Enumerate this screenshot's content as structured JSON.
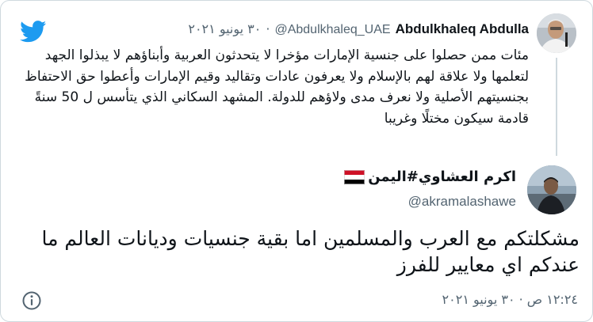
{
  "parent_tweet": {
    "author_name": "Abdulkhaleq Abdulla",
    "handle": "@Abdulkhaleq_UAE",
    "separator": "·",
    "date": "٣٠ يونيو ٢٠٢١",
    "text": "مئات ممن حصلوا على جنسية الإمارات مؤخرا لا يتحدثون العربية وأبناؤهم لا يبذلوا الجهد لتعلمها ولا علاقة لهم بالإسلام ولا يعرفون عادات وتقاليد وقيم الإمارات وأعطوا حق الاحتفاظ بجنسيتهم الأصلية ولا نعرف مدى ولاؤهم للدولة. المشهد السكاني الذي يتأسس ل 50 سنةً قادمة سيكون مختلًا وغريبا"
  },
  "main_tweet": {
    "author_name": "اكرم العشاوي#اليمن",
    "handle": "@akramalashawe",
    "text": "مشكلتكم مع العرب والمسلمين اما بقية جنسيات وديانات العالم ما عندكم اي معايير للفرز",
    "timestamp": "١٢:٢٤ ص · ٣٠ يونيو ٢٠٢١"
  },
  "icons": {
    "brand": "twitter-bird-icon",
    "info": "info-icon",
    "flag": "yemen-flag-icon"
  },
  "colors": {
    "brand_blue": "#1d9bf0",
    "muted_text": "#536471",
    "border": "#cfd9de"
  }
}
